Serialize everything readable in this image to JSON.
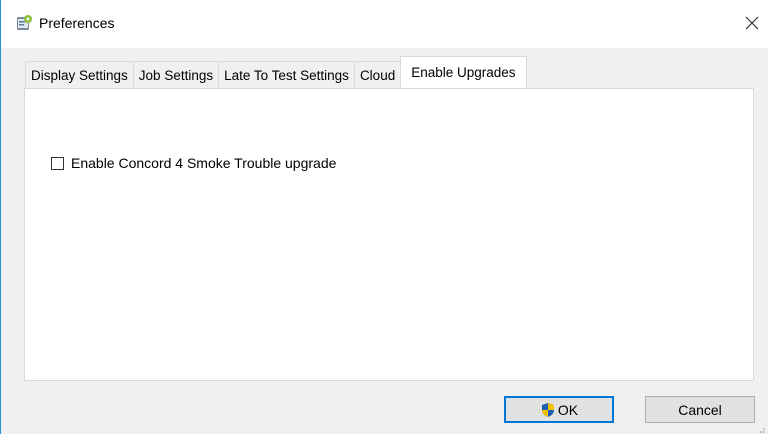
{
  "window": {
    "title": "Preferences"
  },
  "tabs": [
    {
      "label": "Display Settings",
      "active": false
    },
    {
      "label": "Job Settings",
      "active": false
    },
    {
      "label": "Late To Test Settings",
      "active": false
    },
    {
      "label": "Cloud",
      "active": false
    },
    {
      "label": "Enable Upgrades",
      "active": true
    }
  ],
  "panel": {
    "checkbox_label": "Enable Concord 4 Smoke Trouble upgrade",
    "checkbox_checked": false
  },
  "buttons": {
    "ok_label": "OK",
    "cancel_label": "Cancel"
  },
  "colors": {
    "accent": "#0078d7",
    "window_border": "#2b8fd6"
  },
  "icons": {
    "app": "preferences-app-icon",
    "close": "close-icon",
    "ok_shield": "uac-shield-icon"
  }
}
